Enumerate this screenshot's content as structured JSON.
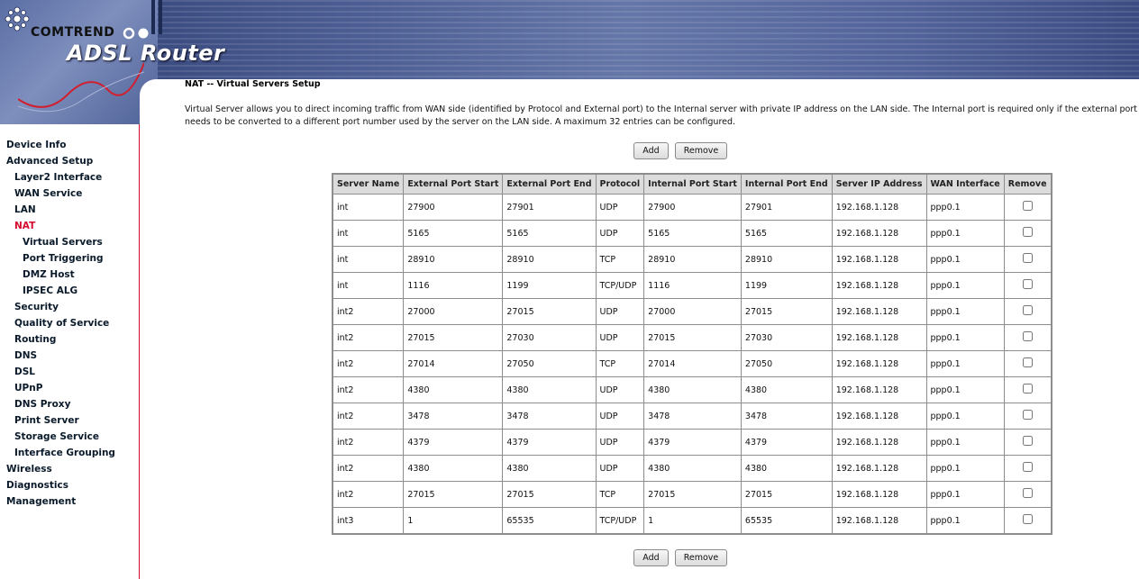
{
  "banner": {
    "brand": "COMTREND",
    "product": "ADSL Router"
  },
  "sidebar": {
    "items": [
      {
        "label": "Device Info",
        "level": 1,
        "active": false
      },
      {
        "label": "Advanced Setup",
        "level": 1,
        "active": false
      },
      {
        "label": "Layer2 Interface",
        "level": 2,
        "active": false
      },
      {
        "label": "WAN Service",
        "level": 2,
        "active": false
      },
      {
        "label": "LAN",
        "level": 2,
        "active": false
      },
      {
        "label": "NAT",
        "level": 2,
        "active": true
      },
      {
        "label": "Virtual Servers",
        "level": 3,
        "active": false
      },
      {
        "label": "Port Triggering",
        "level": 3,
        "active": false
      },
      {
        "label": "DMZ Host",
        "level": 3,
        "active": false
      },
      {
        "label": "IPSEC ALG",
        "level": 3,
        "active": false
      },
      {
        "label": "Security",
        "level": 2,
        "active": false
      },
      {
        "label": "Quality of Service",
        "level": 2,
        "active": false
      },
      {
        "label": "Routing",
        "level": 2,
        "active": false
      },
      {
        "label": "DNS",
        "level": 2,
        "active": false
      },
      {
        "label": "DSL",
        "level": 2,
        "active": false
      },
      {
        "label": "UPnP",
        "level": 2,
        "active": false
      },
      {
        "label": "DNS Proxy",
        "level": 2,
        "active": false
      },
      {
        "label": "Print Server",
        "level": 2,
        "active": false
      },
      {
        "label": "Storage Service",
        "level": 2,
        "active": false
      },
      {
        "label": "Interface Grouping",
        "level": 2,
        "active": false
      },
      {
        "label": "Wireless",
        "level": 1,
        "active": false
      },
      {
        "label": "Diagnostics",
        "level": 1,
        "active": false
      },
      {
        "label": "Management",
        "level": 1,
        "active": false
      }
    ]
  },
  "main": {
    "title": "NAT -- Virtual Servers Setup",
    "description": "Virtual Server allows you to direct incoming traffic from WAN side (identified by Protocol and External port) to the Internal server with private IP address on the LAN side. The Internal port is required only if the external port needs to be converted to a different port number used by the server on the LAN side. A maximum 32 entries can be configured.",
    "add_label": "Add",
    "remove_label": "Remove",
    "table": {
      "headers": [
        "Server Name",
        "External Port Start",
        "External Port End",
        "Protocol",
        "Internal Port Start",
        "Internal Port End",
        "Server IP Address",
        "WAN Interface",
        "Remove"
      ],
      "rows": [
        [
          "int",
          "27900",
          "27901",
          "UDP",
          "27900",
          "27901",
          "192.168.1.128",
          "ppp0.1"
        ],
        [
          "int",
          "5165",
          "5165",
          "UDP",
          "5165",
          "5165",
          "192.168.1.128",
          "ppp0.1"
        ],
        [
          "int",
          "28910",
          "28910",
          "TCP",
          "28910",
          "28910",
          "192.168.1.128",
          "ppp0.1"
        ],
        [
          "int",
          "1116",
          "1199",
          "TCP/UDP",
          "1116",
          "1199",
          "192.168.1.128",
          "ppp0.1"
        ],
        [
          "int2",
          "27000",
          "27015",
          "UDP",
          "27000",
          "27015",
          "192.168.1.128",
          "ppp0.1"
        ],
        [
          "int2",
          "27015",
          "27030",
          "UDP",
          "27015",
          "27030",
          "192.168.1.128",
          "ppp0.1"
        ],
        [
          "int2",
          "27014",
          "27050",
          "TCP",
          "27014",
          "27050",
          "192.168.1.128",
          "ppp0.1"
        ],
        [
          "int2",
          "4380",
          "4380",
          "UDP",
          "4380",
          "4380",
          "192.168.1.128",
          "ppp0.1"
        ],
        [
          "int2",
          "3478",
          "3478",
          "UDP",
          "3478",
          "3478",
          "192.168.1.128",
          "ppp0.1"
        ],
        [
          "int2",
          "4379",
          "4379",
          "UDP",
          "4379",
          "4379",
          "192.168.1.128",
          "ppp0.1"
        ],
        [
          "int2",
          "4380",
          "4380",
          "UDP",
          "4380",
          "4380",
          "192.168.1.128",
          "ppp0.1"
        ],
        [
          "int2",
          "27015",
          "27015",
          "TCP",
          "27015",
          "27015",
          "192.168.1.128",
          "ppp0.1"
        ],
        [
          "int3",
          "1",
          "65535",
          "TCP/UDP",
          "1",
          "65535",
          "192.168.1.128",
          "ppp0.1"
        ]
      ]
    }
  },
  "colors": {
    "active_nav": "#d50a2f",
    "sidebar_border": "#d60a2a",
    "header_bg": "#dcdcdc"
  }
}
